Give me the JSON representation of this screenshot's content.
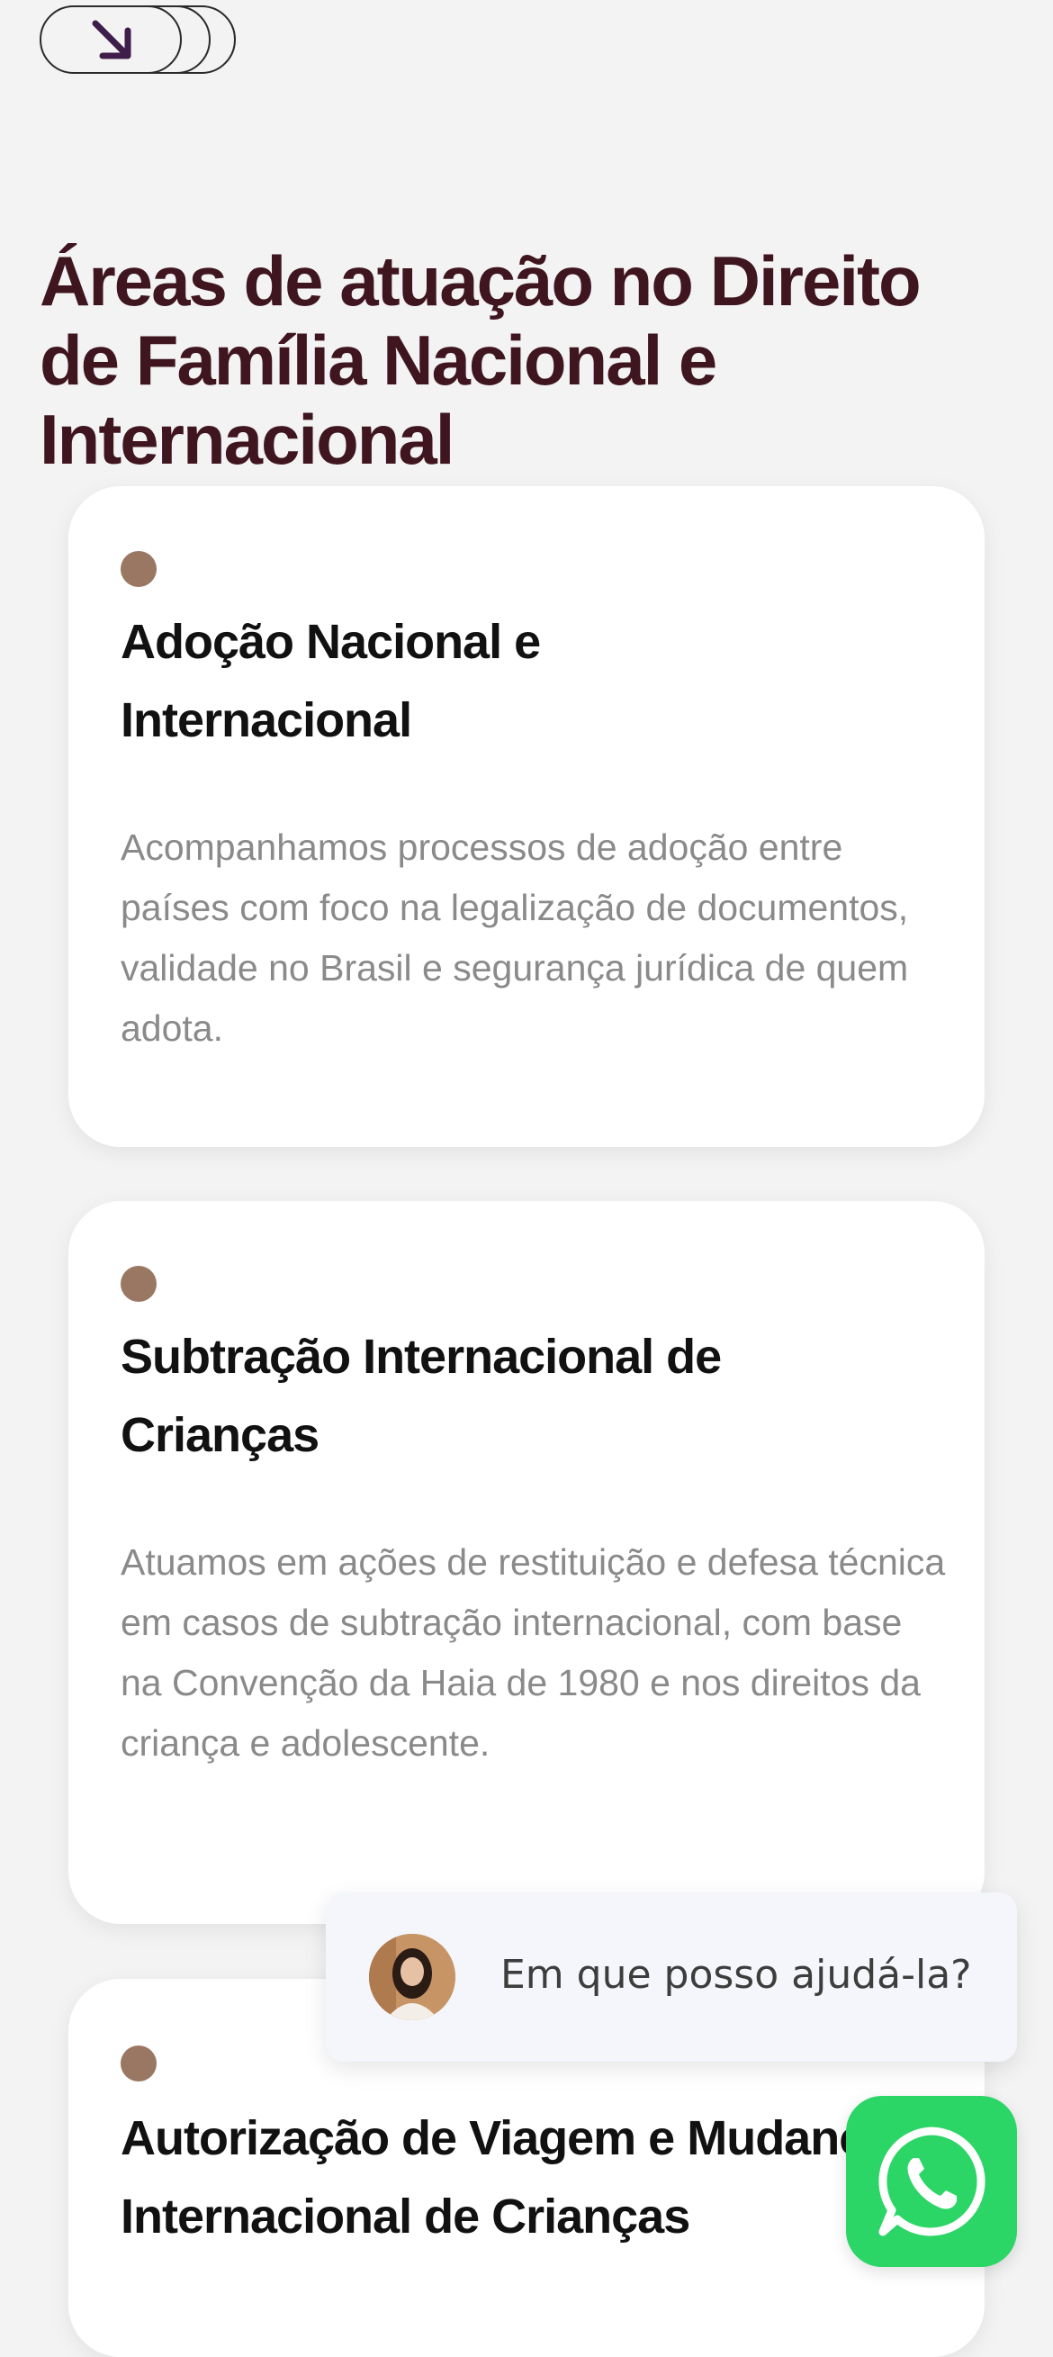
{
  "section": {
    "title": "Áreas de atuação no Direito de Família Nacional e Internacional"
  },
  "cards": [
    {
      "title": "Adoção Nacional e Internacional",
      "description": "Acompanhamos processos de adoção entre países com foco na legalização de documentos, validade no Brasil e segurança jurídica de quem adota."
    },
    {
      "title": "Subtração Internacional de Crianças",
      "description": "Atuamos em ações de restituição e defesa técnica em casos de subtração internacional, com base na Convenção da Haia de 1980 e nos direitos da criança e adolescente."
    },
    {
      "title": "Autorização de Viagem e Mudança Internacional de Crianças",
      "description": ""
    }
  ],
  "chat": {
    "message": "Em que posso ajudá-la?"
  },
  "icons": {
    "scroll": "arrow-down-right-icon",
    "whatsapp": "whatsapp-icon"
  },
  "colors": {
    "title": "#3f1520",
    "accent_dot": "#9a7763",
    "whatsapp": "#2bd566"
  }
}
